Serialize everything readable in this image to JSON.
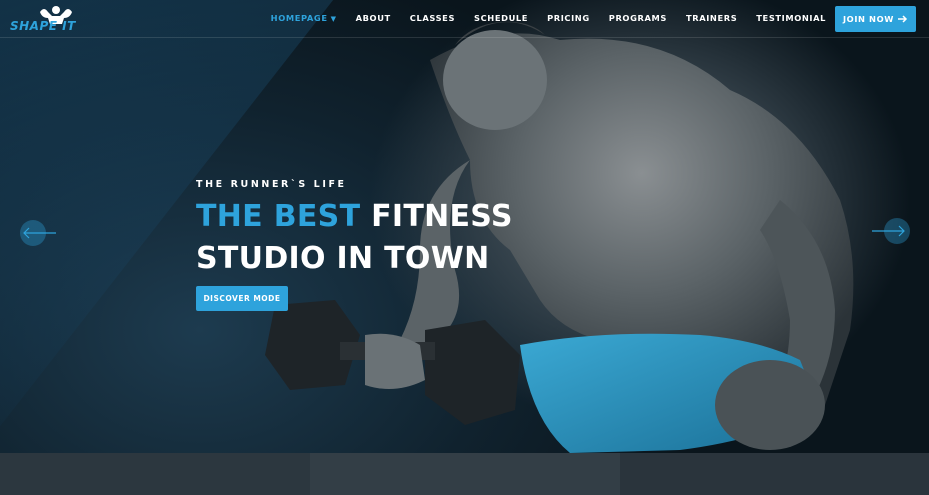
{
  "brand": {
    "logo_text": "SHAPE IT"
  },
  "nav": {
    "items": [
      {
        "label": "HOMEPAGE",
        "active": true,
        "has_dropdown": true
      },
      {
        "label": "ABOUT"
      },
      {
        "label": "CLASSES"
      },
      {
        "label": "SCHEDULE"
      },
      {
        "label": "PRICING"
      },
      {
        "label": "PROGRAMS"
      },
      {
        "label": "TRAINERS"
      },
      {
        "label": "TESTIMONIAL"
      }
    ],
    "join_label": "JOIN NOW",
    "dropdown_icon": "caret-down-icon",
    "join_icon": "arrow-right-icon"
  },
  "hero": {
    "eyebrow": "THE RUNNER`S LIFE",
    "headline_accent": "THE BEST",
    "headline_rest_1": " FITNESS",
    "headline_rest_2": "STUDIO IN TOWN",
    "cta_label": "DISCOVER MODE",
    "prev_icon": "arrow-left-icon",
    "next_icon": "arrow-right-icon"
  },
  "colors": {
    "accent": "#2ea3dc",
    "text": "#ffffff",
    "dark": "#0d1a22"
  }
}
